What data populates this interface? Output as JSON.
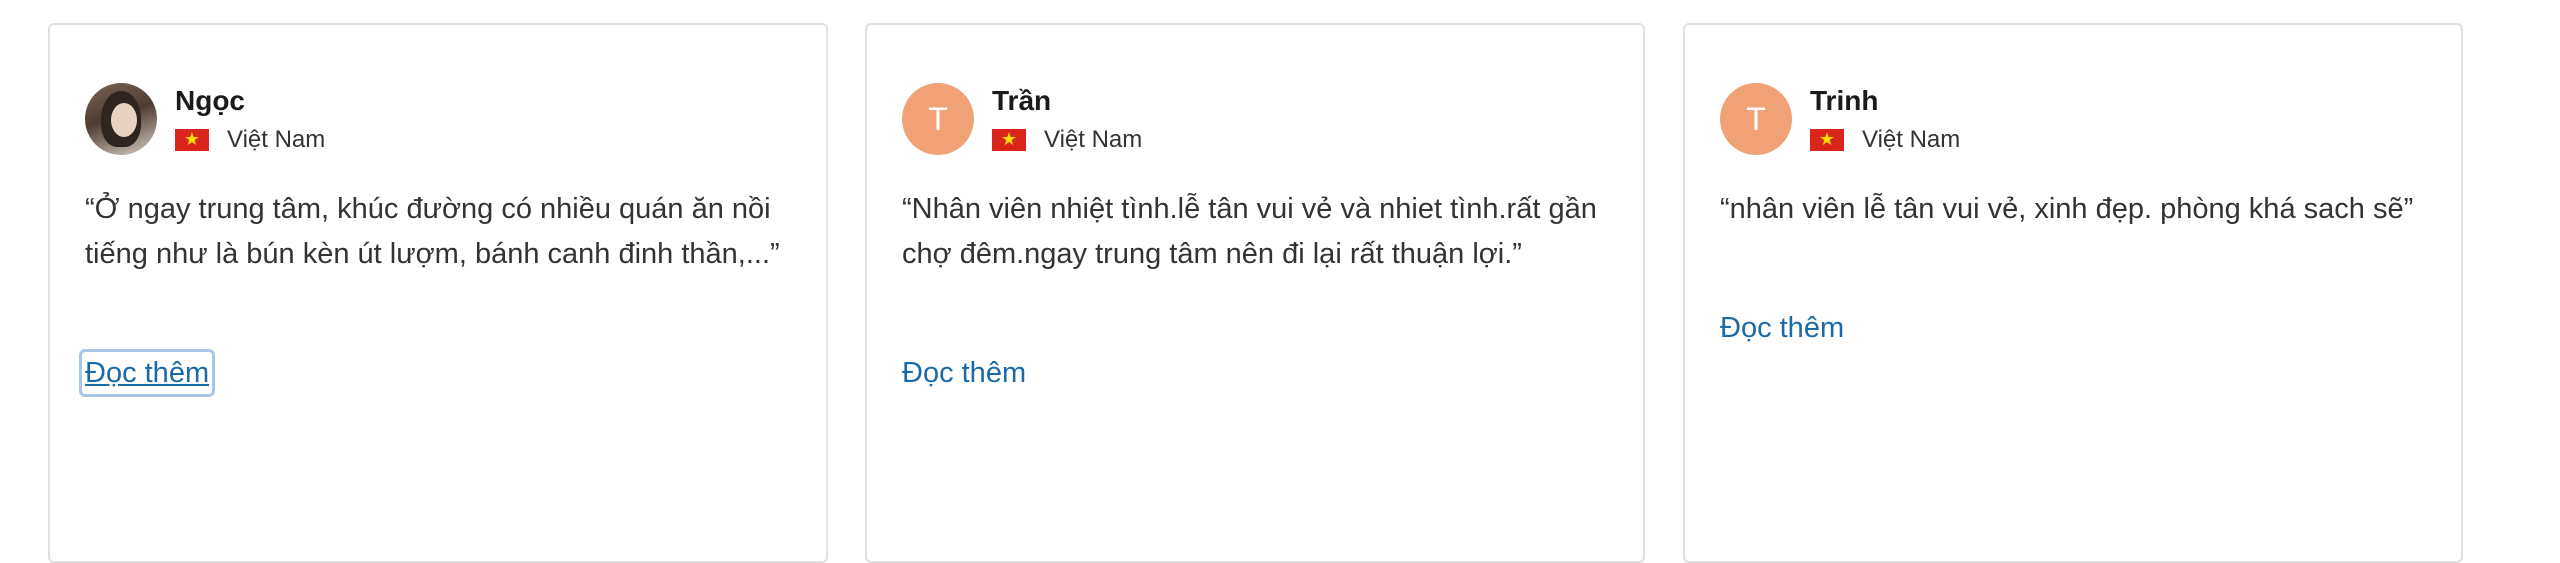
{
  "reviews": [
    {
      "name": "Ngọc",
      "avatar_type": "photo",
      "avatar_initial": "",
      "country": "Việt Nam",
      "flag_icon": "vietnam-flag-icon",
      "quote": "“Ở ngay trung tâm, khúc đường có nhiều quán ăn nồi tiếng như là bún kèn út lượm, bánh canh đinh thần,...”",
      "read_more": "Đọc thêm"
    },
    {
      "name": "Trần",
      "avatar_type": "initial",
      "avatar_initial": "T",
      "country": "Việt Nam",
      "flag_icon": "vietnam-flag-icon",
      "quote": "“Nhân viên nhiệt tình.lễ tân vui vẻ và nhiet tình.rất gần chợ đêm.ngay trung tâm nên đi lại rất thuận lợi.”",
      "read_more": "Đọc thêm"
    },
    {
      "name": "Trinh",
      "avatar_type": "initial",
      "avatar_initial": "T",
      "country": "Việt Nam",
      "flag_icon": "vietnam-flag-icon",
      "quote": "“nhân viên lễ tân vui vẻ, xinh đẹp. phòng khá sach sẽ”",
      "read_more": "Đọc thêm"
    }
  ],
  "colors": {
    "avatar_bg": "#f0a276",
    "link": "#1b6aa8",
    "flag_red": "#da251d",
    "flag_star": "#ffdd00"
  }
}
